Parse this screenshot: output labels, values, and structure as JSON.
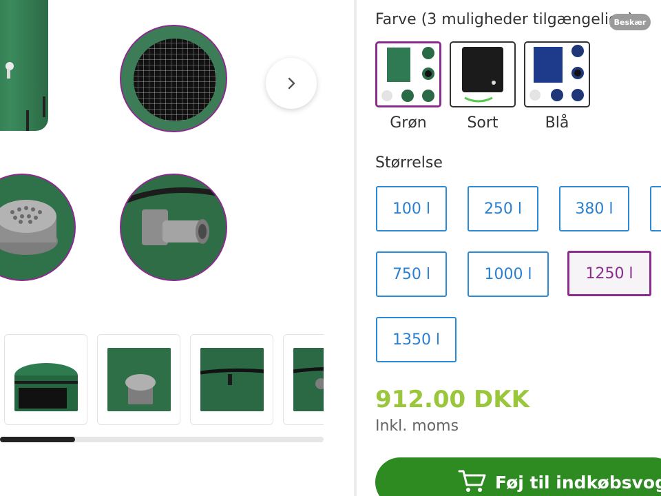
{
  "gallery": {
    "next_label": "›"
  },
  "colors": {
    "heading": "Farve (3 muligheder tilgængelige)",
    "crop_badge": "Beskær",
    "options": [
      {
        "label": "Grøn",
        "selected": true,
        "tint": "#2f7a52"
      },
      {
        "label": "Sort",
        "selected": false,
        "tint": "#1b1b1b"
      },
      {
        "label": "Blå",
        "selected": false,
        "tint": "#1e3a8a"
      }
    ]
  },
  "sizes": {
    "heading": "Størrelse",
    "options": [
      {
        "label": "100 l",
        "selected": false
      },
      {
        "label": "250 l",
        "selected": false
      },
      {
        "label": "380 l",
        "selected": false
      },
      {
        "label": "750 l",
        "selected": false
      },
      {
        "label": "1000 l",
        "selected": false
      },
      {
        "label": "1250 l",
        "selected": true
      },
      {
        "label": "1350 l",
        "selected": false
      }
    ]
  },
  "price": {
    "amount": "912.00 DKK",
    "vat_note": "Inkl. moms"
  },
  "cart": {
    "label": "Føj til indkøbsvogn"
  },
  "theme": {
    "accent_purple": "#8a2b8d",
    "size_blue": "#2b8ad6",
    "price_green": "#99c63b",
    "cart_green": "#2e8b22"
  }
}
